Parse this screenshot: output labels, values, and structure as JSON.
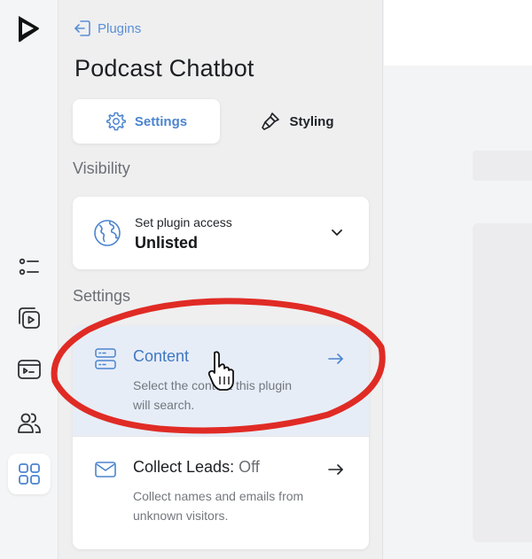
{
  "rail": {
    "logo_icon": "play-triangle-logo",
    "items": [
      {
        "icon": "list-icon"
      },
      {
        "icon": "video-library-icon"
      },
      {
        "icon": "player-icon"
      },
      {
        "icon": "users-icon"
      },
      {
        "icon": "plugins-grid-icon"
      }
    ],
    "accent": "#4b84cf"
  },
  "panel": {
    "back_label": "Plugins",
    "title": "Podcast Chatbot",
    "tabs": [
      {
        "label": "Settings",
        "icon": "gear-icon",
        "active": true
      },
      {
        "label": "Styling",
        "icon": "brush-icon",
        "active": false
      }
    ],
    "visibility": {
      "section_label": "Visibility",
      "kicker": "Set plugin access",
      "value": "Unlisted",
      "icon": "globe-icon"
    },
    "settings": {
      "section_label": "Settings",
      "options": [
        {
          "title": "Content",
          "status": "",
          "description": "Select the content this plugin will search.",
          "icon": "server-stack-icon",
          "highlighted": true
        },
        {
          "title": "Collect Leads: ",
          "status": "Off",
          "description": "Collect names and emails from unknown visitors.",
          "icon": "envelope-icon",
          "highlighted": false
        }
      ]
    }
  },
  "colors": {
    "link": "#5a8fd6",
    "annotation_red": "#e02b25",
    "highlight_bg": "#e7edf7"
  }
}
